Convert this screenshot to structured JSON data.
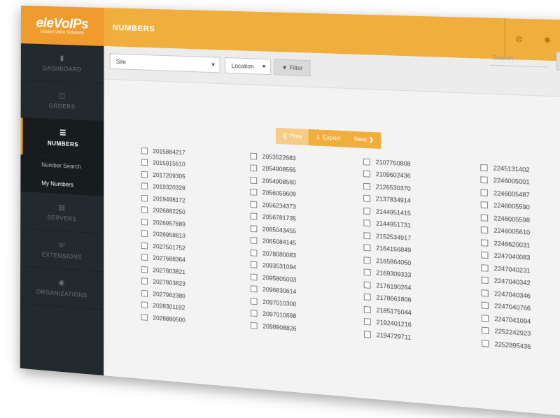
{
  "logo": {
    "name": "eleVoIPs",
    "tagline": "Hosted Voice Solutions"
  },
  "header": {
    "title": "NUMBERS",
    "icons": [
      "gear-icon",
      "user-icon",
      "power-icon"
    ]
  },
  "sidebar": {
    "items": [
      {
        "label": "DASHBOARD",
        "icon": "bar-chart-icon"
      },
      {
        "label": "ORDERS",
        "icon": "cart-icon"
      },
      {
        "label": "NUMBERS",
        "icon": "list-icon"
      },
      {
        "label": "SERVERS",
        "icon": "server-icon"
      },
      {
        "label": "EXTENSIONS",
        "icon": "phone-icon"
      },
      {
        "label": "ORGANIZATIONS",
        "icon": "globe-icon"
      }
    ],
    "subitems": [
      "Number Search",
      "My Numbers"
    ]
  },
  "filters": {
    "site": "Site",
    "location": "Location",
    "filter_label": "Filter",
    "search_placeholder": "Search"
  },
  "pager": {
    "prev": "Prev",
    "export": "Export",
    "next": "Next"
  },
  "numbers": [
    [
      "2015884217",
      "2015915610",
      "2017209305",
      "2019320328",
      "2019498172",
      "2026882250",
      "2026957689",
      "2026958813",
      "2027501752",
      "2027688364",
      "2027803821",
      "2027803823",
      "2027962380",
      "2028301192",
      "2028880500"
    ],
    [
      "2053522683",
      "2054908555",
      "2054908560",
      "2056059609",
      "2056234373",
      "2056781735",
      "2065043455",
      "2065084145",
      "2078080083",
      "2093531094",
      "2095805003",
      "2096830614",
      "2097010300",
      "2097010698",
      "2098908826"
    ],
    [
      "2107750808",
      "2109602436",
      "2126530370",
      "2137834914",
      "2144951415",
      "2144951731",
      "2152534917",
      "2164156849",
      "2165864050",
      "2169309333",
      "2176190264",
      "2178661806",
      "2185175044",
      "2192401216",
      "2194729711"
    ],
    [
      "2245131402",
      "2246005001",
      "2246005487",
      "2246005590",
      "2246005598",
      "2246005610",
      "2246620031",
      "2247040083",
      "2247040231",
      "2247040342",
      "2247040346",
      "2247040766",
      "2247041094",
      "2252242923",
      "2252895436"
    ]
  ]
}
